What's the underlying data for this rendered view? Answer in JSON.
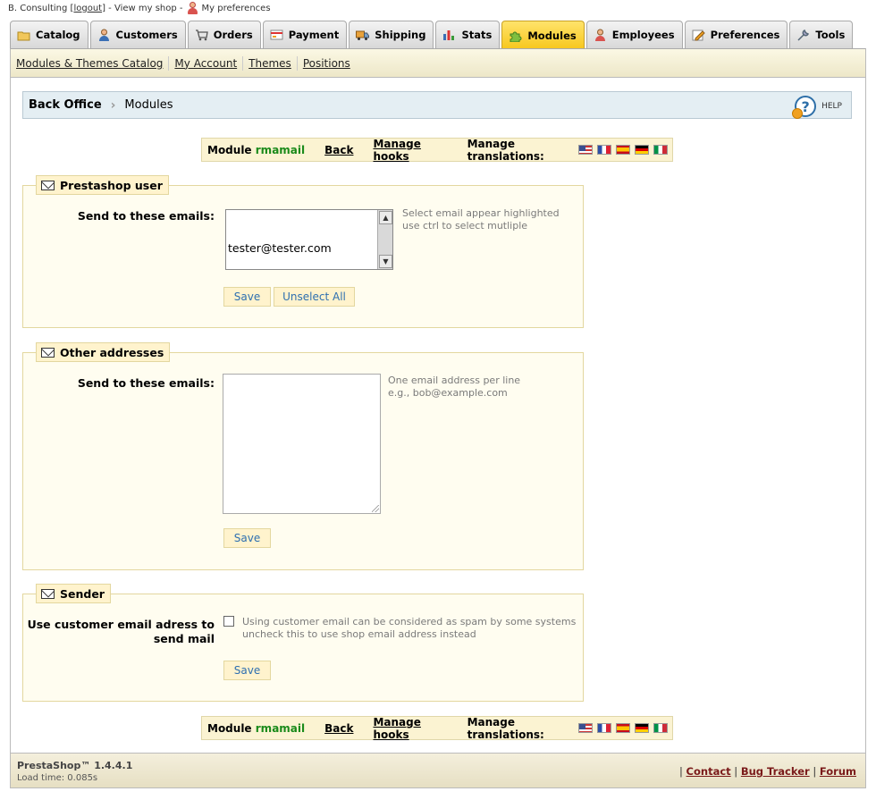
{
  "topbar": {
    "shop_name": "B. Consulting [",
    "logout": "logout",
    "after_logout": "] - View my shop -",
    "preferences": "My preferences"
  },
  "tabs": [
    {
      "label": "Catalog",
      "icon": "folder-icon",
      "active": false
    },
    {
      "label": "Customers",
      "icon": "customer-icon",
      "active": false
    },
    {
      "label": "Orders",
      "icon": "cart-icon",
      "active": false
    },
    {
      "label": "Payment",
      "icon": "payment-icon",
      "active": false
    },
    {
      "label": "Shipping",
      "icon": "truck-icon",
      "active": false
    },
    {
      "label": "Stats",
      "icon": "chart-icon",
      "active": false
    },
    {
      "label": "Modules",
      "icon": "puzzle-icon",
      "active": true
    },
    {
      "label": "Employees",
      "icon": "employee-icon",
      "active": false
    },
    {
      "label": "Preferences",
      "icon": "preferences-icon",
      "active": false
    },
    {
      "label": "Tools",
      "icon": "wrench-icon",
      "active": false
    }
  ],
  "subnav": [
    "Modules & Themes Catalog",
    "My Account",
    "Themes",
    "Positions"
  ],
  "breadcrumb": {
    "root": "Back Office",
    "current": "Modules",
    "help": "HELP"
  },
  "module_bar": {
    "module_prefix": "Module",
    "module_name": "rmamail",
    "back": "Back",
    "manage_hooks": "Manage hooks",
    "manage_translations": "Manage translations:",
    "flags": [
      "us",
      "fr",
      "es",
      "de",
      "it"
    ]
  },
  "prestashop_user": {
    "legend": "Prestashop user",
    "label": "Send to these emails:",
    "options": [
      "tester@tester.com"
    ],
    "hint_line1": "Select email appear highlighted",
    "hint_line2": "use ctrl to select mutliple",
    "save": "Save",
    "unselect_all": "Unselect All"
  },
  "other_addresses": {
    "legend": "Other addresses",
    "label": "Send to these emails:",
    "value": "",
    "hint_line1": "One email address per line",
    "hint_line2": "e.g., bob@example.com",
    "save": "Save"
  },
  "sender": {
    "legend": "Sender",
    "label_line1": "Use customer email adress to",
    "label_line2": "send mail",
    "checked": false,
    "hint_line1": "Using customer email can be considered as spam by some systems",
    "hint_line2": "uncheck this to use shop email address instead",
    "save": "Save"
  },
  "footer": {
    "version": "PrestaShop™ 1.4.4.1",
    "load_time": "Load time: 0.085s",
    "contact": "Contact",
    "bug_tracker": "Bug Tracker",
    "forum": "Forum"
  }
}
